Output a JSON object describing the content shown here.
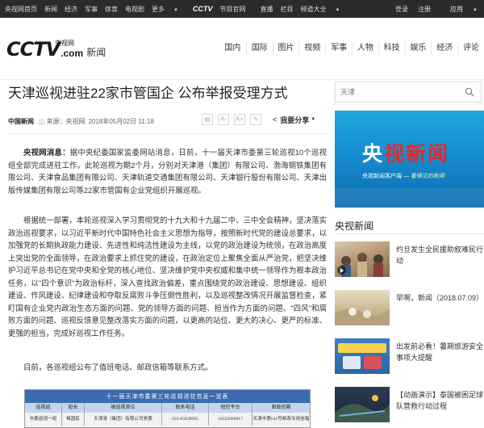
{
  "topbar": {
    "left": [
      "央视网首页",
      "新闻",
      "经济",
      "军事",
      "体育",
      "电视剧",
      "更多"
    ],
    "mid_brand": "CCTV",
    "mid_label": "节目官网",
    "mid_more": [
      "直播",
      "栏目",
      "频道大全"
    ],
    "right": [
      "登录",
      "注册",
      "应用"
    ]
  },
  "header": {
    "logo_text": "CCTV",
    "logo_domain": ".com",
    "logo_cn": "央视网",
    "section": "新闻",
    "nav": [
      "国内",
      "国际",
      "图片",
      "视频",
      "军事",
      "人物",
      "科技",
      "娱乐",
      "经济",
      "评论"
    ]
  },
  "article": {
    "title": "天津巡视进驻22家市管国企 公布举报受理方式",
    "source_brand": "中国新闻",
    "source_label": "来源：央视网",
    "date": "2018年05月02日 11:18",
    "tools": [
      "A-",
      "A+"
    ],
    "share": "我要分享",
    "p1_lead": "央视网消息：",
    "p1": "据中央纪委国家监委网站消息，日前，十一届天津市委第三轮巡视10个巡视组全部完成进驻工作。此轮巡视为期2个月，分别对天津港（集团）有限公司、渤海钢铁集团有限公司、天津食品集团有限公司、天津轨道交通集团有限公司、天津银行股份有限公司、天津出版传媒集团有限公司等22家市管国有企业党组织开展巡视。",
    "p2": "根据统一部署，本轮巡视深入学习贯彻党的十九大和十九届二中、三中全会精神，坚决落实政治巡视要求，以习近平新时代中国特色社会主义思想为指导，按照新时代党的建设总要求，以加强党的长期执政能力建设、先进性和纯洁性建设为主线，以党的政治建设为统领，在政治高度上突出党的全面领导，在政治要求上抓住党的建设，在政治定位上聚焦全面从严治党，把坚决维护习近平总书记在党中央和全党的核心地位、坚决维护党中央权威和集中统一领导作为根本政治任务，以\"四个意识\"为政治标杆，深入查找政治偏差，重点围绕党的政治建设、思想建设、组织建设、作风建设、纪律建设和夺取反腐败斗争压倒性胜利，以及巡视整改情况开展监督检查，紧盯国有企业党内政治生态方面的问题、党的领导方面的问题、担当作为方面的问题、\"四风\"和腐败方面的问题、巡视反馈意见整改落实方面的问题，以更高的站位、更大的决心、更严的标准、更强的担当，完成好巡视工作任务。",
    "p3": "目前，各巡视组公布了值班电话、邮政信箱等联系方式。"
  },
  "table": {
    "caption": "十一届天津市委第三轮巡视进驻信息一览表",
    "headers": [
      "巡视组",
      "组长",
      "被巡视单位",
      "联系电话",
      "短信平台",
      "邮政信箱"
    ],
    "row": [
      "市委巡视一组",
      "梅国民",
      "天津港（集团）有限公司党委",
      "022-65838995",
      "18222086817",
      "天津市第642号邮政专用信箱"
    ]
  },
  "sidebar": {
    "search_placeholder": "天津",
    "banner_title_a": "央",
    "banner_title_b": "视新闻",
    "banner_sub": "央视新闻客户端 —",
    "banner_slogan": "看得见的新闻",
    "section_title": "央视新闻",
    "items": [
      {
        "text": "约旦发生全民援助叙难民行动",
        "video": true
      },
      {
        "text": "早啊，新闻（2018.07.09）",
        "video": false
      },
      {
        "text": "出发前必看！暑期旅游安全事项大提醒",
        "video": false
      },
      {
        "text": "【动画演示】泰国被困足球队营救行动过程",
        "video": false
      }
    ]
  },
  "colors": {
    "topbar_bg": "#2b2b2b",
    "banner_blue": "#1fa8e0",
    "banner_red": "#e42a2a",
    "table_caption": "#3c6bb0"
  }
}
